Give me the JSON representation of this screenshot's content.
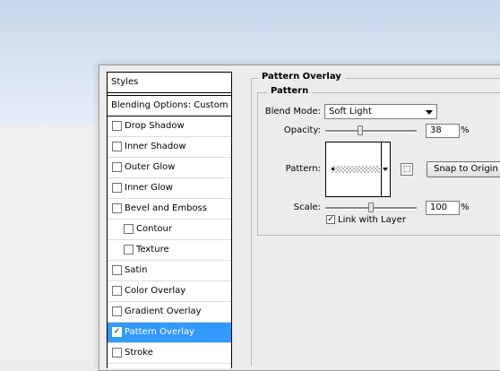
{
  "styles_panel": {
    "header": "Styles",
    "blending_options": "Blending Options: Custom",
    "items": [
      {
        "label": "Drop Shadow",
        "checked": false,
        "level": 0
      },
      {
        "label": "Inner Shadow",
        "checked": false,
        "level": 0
      },
      {
        "label": "Outer Glow",
        "checked": false,
        "level": 0
      },
      {
        "label": "Inner Glow",
        "checked": false,
        "level": 0
      },
      {
        "label": "Bevel and Emboss",
        "checked": false,
        "level": 0
      },
      {
        "label": "Contour",
        "checked": false,
        "level": 1
      },
      {
        "label": "Texture",
        "checked": false,
        "level": 1
      },
      {
        "label": "Satin",
        "checked": false,
        "level": 0
      },
      {
        "label": "Color Overlay",
        "checked": false,
        "level": 0
      },
      {
        "label": "Gradient Overlay",
        "checked": false,
        "level": 0
      },
      {
        "label": "Pattern Overlay",
        "checked": true,
        "level": 0,
        "selected": true
      },
      {
        "label": "Stroke",
        "checked": false,
        "level": 0
      }
    ]
  },
  "pattern_overlay": {
    "title": "Pattern Overlay",
    "group": "Pattern",
    "blend_mode_label": "Blend Mode:",
    "blend_mode_value": "Soft Light",
    "opacity_label": "Opacity:",
    "opacity_value": "38",
    "opacity_unit": "%",
    "pattern_label": "Pattern:",
    "snap_button": "Snap to Origin",
    "scale_label": "Scale:",
    "scale_value": "100",
    "scale_unit": "%",
    "link_label": "Link with Layer",
    "link_checked": true
  },
  "colors": {
    "selection": "#3399ff"
  }
}
